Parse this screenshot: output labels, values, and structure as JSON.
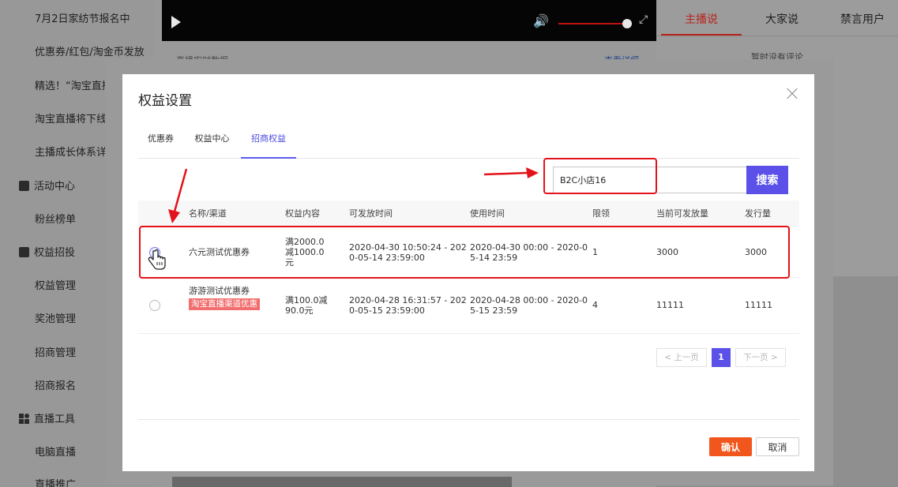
{
  "sidebar": {
    "items": [
      {
        "label": "7月2日家纺节报名中",
        "kind": "link"
      },
      {
        "label": "优惠券/红包/淘金币发放",
        "kind": "link"
      },
      {
        "label": "精选！“淘宝直播",
        "kind": "link"
      },
      {
        "label": "淘宝直播将下线",
        "kind": "link"
      },
      {
        "label": "主播成长体系详",
        "kind": "link"
      },
      {
        "label": "活动中心",
        "kind": "group",
        "icon": "activity-icon"
      },
      {
        "label": "粉丝榜单",
        "kind": "link"
      },
      {
        "label": "权益招投",
        "kind": "group",
        "icon": "benefit-icon"
      },
      {
        "label": "权益管理",
        "kind": "link"
      },
      {
        "label": "奖池管理",
        "kind": "link"
      },
      {
        "label": "招商管理",
        "kind": "link"
      },
      {
        "label": "招商报名",
        "kind": "link"
      },
      {
        "label": "直播工具",
        "kind": "group",
        "icon": "tools-icon"
      },
      {
        "label": "电脑直播",
        "kind": "link"
      },
      {
        "label": "直播推广",
        "kind": "link"
      }
    ]
  },
  "video": {
    "play_icon": "play-icon",
    "volume_icon": "volume-icon",
    "fullscreen_icon": "fullscreen-icon"
  },
  "background": {
    "strip_title": "直播实时数据",
    "strip_link": "查看详细"
  },
  "right_panel": {
    "tabs": [
      "主播说",
      "大家说",
      "禁言用户"
    ],
    "active_tab": "主播说",
    "empty_text": "暂时没有评论"
  },
  "modal": {
    "title": "权益设置",
    "close_icon": "close-icon",
    "tabs": [
      "优惠券",
      "权益中心",
      "招商权益"
    ],
    "active_tab": "招商权益",
    "search": {
      "value": "B2C小店16",
      "button": "搜索"
    },
    "columns": [
      "名称/渠道",
      "权益内容",
      "可发放时间",
      "使用时间",
      "限领",
      "当前可发放量",
      "发行量"
    ],
    "rows": [
      {
        "name": "六元测试优惠券",
        "tag": "",
        "content": [
          "满2000.0",
          "减1000.0",
          "元"
        ],
        "issue_time": [
          "2020-04-30 10:50:24 - 202",
          "0-05-14 23:59:00"
        ],
        "use_time": [
          "2020-04-30 00:00 - 2020-0",
          "5-14 23:59"
        ],
        "limit": "1",
        "available": "3000",
        "total": "3000",
        "selected": false
      },
      {
        "name": "游游测试优惠券",
        "tag": "淘宝直播渠道优惠",
        "content": [
          "满100.0减",
          "90.0元"
        ],
        "issue_time": [
          "2020-04-28 16:31:57 - 202",
          "0-05-15 23:59:00"
        ],
        "use_time": [
          "2020-04-28 00:00 - 2020-0",
          "5-15 23:59"
        ],
        "limit": "4",
        "available": "11111",
        "total": "11111",
        "selected": false
      }
    ],
    "pagination": {
      "prev": "< 上一页",
      "current": "1",
      "next": "下一页 >"
    },
    "confirm": "确认",
    "cancel": "取消"
  },
  "colors": {
    "accent": "#5b50e8",
    "confirm": "#f1571d",
    "annotation": "#e2131a",
    "live_red": "#b8231b",
    "tag": "#f26e6e"
  }
}
